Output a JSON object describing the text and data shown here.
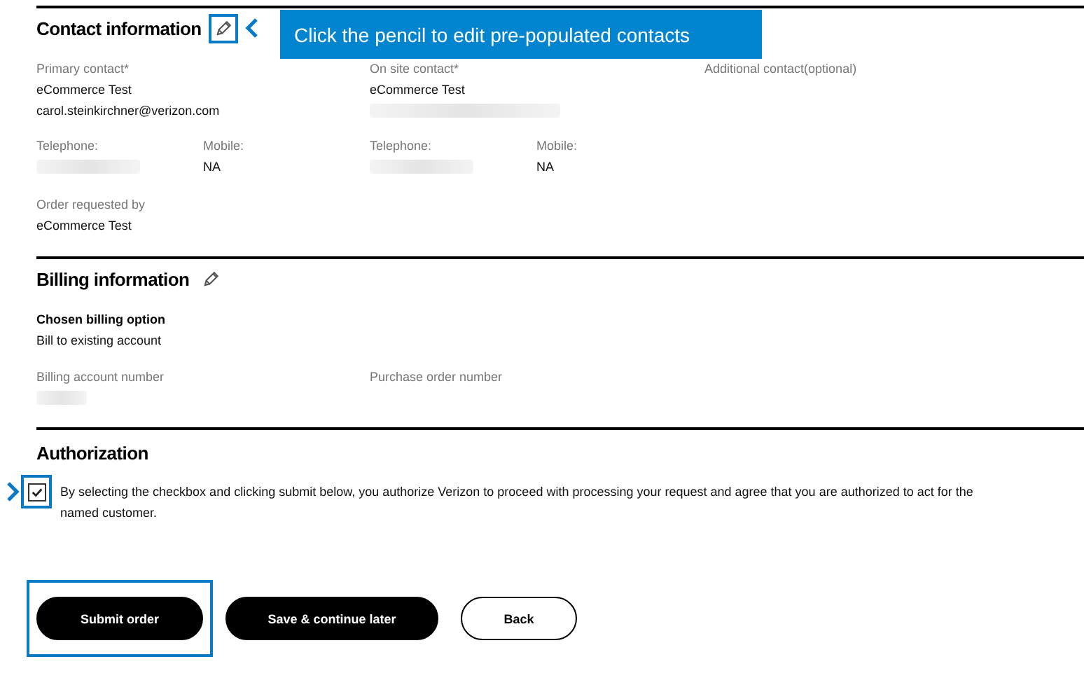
{
  "contact": {
    "title": "Contact information",
    "callout": "Click the pencil to edit pre-populated contacts",
    "columns": [
      {
        "label": "Primary contact*",
        "lines": [
          {
            "text": "eCommerce Test"
          },
          {
            "text": "carol.steinkirchner@verizon.com"
          }
        ]
      },
      {
        "label": "On site contact*",
        "lines": [
          {
            "text": "eCommerce Test"
          },
          {
            "redacted": true
          }
        ]
      },
      {
        "label": "Additional contact(optional)"
      }
    ],
    "phones": [
      {
        "label": "Telephone:",
        "redacted": true
      },
      {
        "label": "Mobile:",
        "value": "NA"
      },
      {
        "label": "Telephone:",
        "redacted": true
      },
      {
        "label": "Mobile:",
        "value": "NA"
      }
    ],
    "requested": {
      "label": "Order requested by",
      "value": "eCommerce Test"
    }
  },
  "billing": {
    "title": "Billing information",
    "option_label": "Chosen billing option",
    "option_value": "Bill to existing account",
    "fields": [
      {
        "label": "Billing account number",
        "redacted": true
      },
      {
        "label": "Purchase order number"
      }
    ]
  },
  "authorization": {
    "title": "Authorization",
    "checked": true,
    "text": "By selecting the checkbox and clicking submit below, you authorize Verizon to proceed with processing your request and agree that you are authorized to act for the named customer."
  },
  "buttons": [
    {
      "label": "Submit order",
      "kind": "primary",
      "highlighted": true
    },
    {
      "label": "Save & continue later",
      "kind": "primary",
      "highlighted": false
    },
    {
      "label": "Back",
      "kind": "secondary",
      "highlighted": false
    }
  ]
}
